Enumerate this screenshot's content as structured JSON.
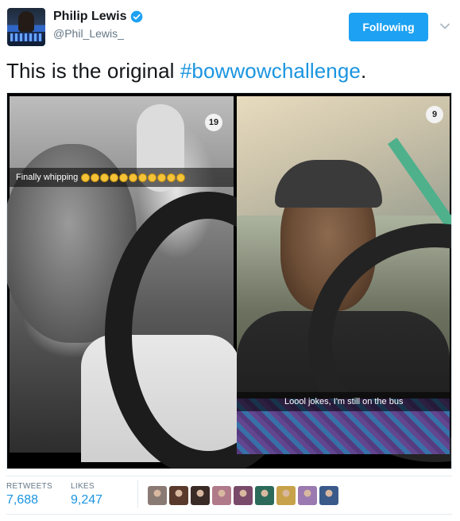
{
  "header": {
    "display_name": "Philip Lewis",
    "handle": "@Phil_Lewis_",
    "follow_label": "Following"
  },
  "tweet": {
    "text_prefix": "This is the original ",
    "hashtag": "#bowwowchallenge",
    "text_suffix": "."
  },
  "media": {
    "left_photo": {
      "counter": "19",
      "caption": "Finally whipping"
    },
    "right_photo": {
      "counter": "9",
      "caption": "Loool jokes, I'm still on the bus"
    }
  },
  "stats": {
    "retweets_label": "RETWEETS",
    "retweets_value": "7,688",
    "likes_label": "LIKES",
    "likes_value": "9,247"
  },
  "likers": [
    {
      "color": "#8a7a74"
    },
    {
      "color": "#5a3a2c"
    },
    {
      "color": "#3b2b27"
    },
    {
      "color": "#b07a8a"
    },
    {
      "color": "#7a4a6a"
    },
    {
      "color": "#2c6a5a"
    },
    {
      "color": "#c8a24a"
    },
    {
      "color": "#9a7ab0"
    },
    {
      "color": "#3a5a8a"
    }
  ],
  "colors": {
    "accent": "#1da1f2",
    "link": "#1b95e0",
    "verified": "#1da1f2"
  }
}
